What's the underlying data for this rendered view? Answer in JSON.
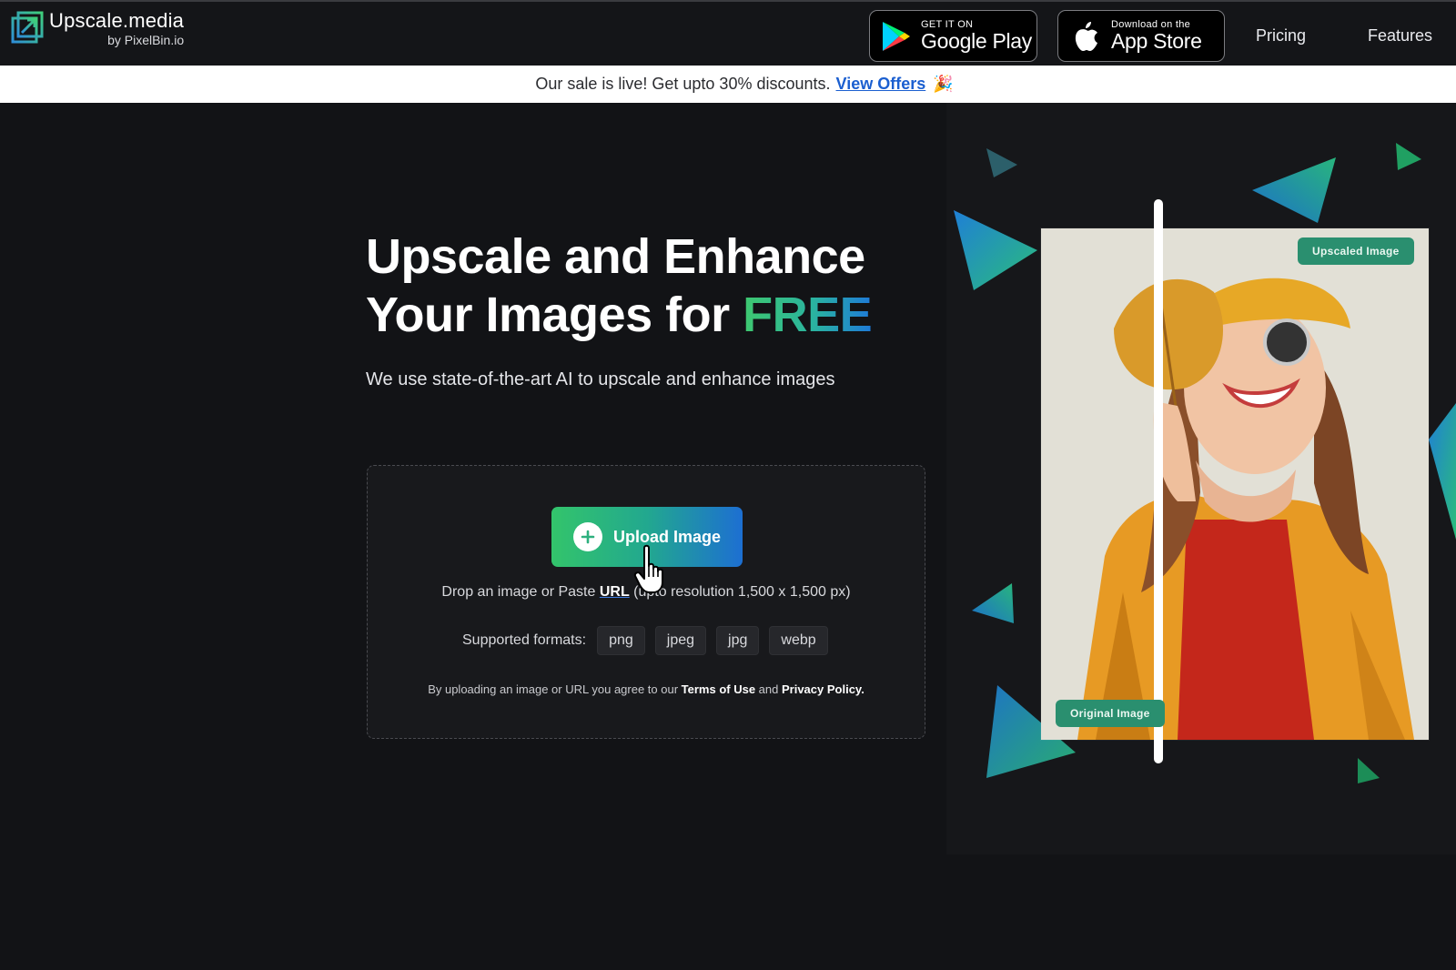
{
  "header": {
    "logo_name": "Upscale.media",
    "logo_sub": "by PixelBin.io",
    "google_play": {
      "small": "GET IT ON",
      "big": "Google Play"
    },
    "app_store": {
      "small": "Download on the",
      "big": "App Store"
    },
    "nav": {
      "pricing": "Pricing",
      "features": "Features"
    }
  },
  "banner": {
    "text": "Our sale is live! Get upto 30% discounts.",
    "link": "View Offers",
    "emoji": "🎉"
  },
  "hero": {
    "title_line1": "Upscale and Enhance",
    "title_line2_prefix": "Your Images for ",
    "title_highlight": "FREE",
    "subtitle": "We use state-of-the-art AI to upscale and enhance images"
  },
  "upload": {
    "button_label": "Upload Image",
    "drop_prefix": "Drop an image or Paste ",
    "drop_url": "URL",
    "drop_suffix": " (upto resolution 1,500 x 1,500 px)",
    "formats_label": "Supported formats:",
    "formats": [
      "png",
      "jpeg",
      "jpg",
      "webp"
    ],
    "terms_prefix": "By uploading an image or URL you agree to our ",
    "terms_link": "Terms of Use",
    "terms_mid": " and ",
    "privacy_link": "Privacy Policy."
  },
  "visual": {
    "tag_upscaled": "Upscaled Image",
    "tag_original": "Original Image"
  },
  "colors": {
    "background": "#121316",
    "accent_green": "#33c46b",
    "accent_blue": "#1d6fd2",
    "link_blue": "#1b5fd0",
    "tag_green": "#2a8f6f"
  }
}
